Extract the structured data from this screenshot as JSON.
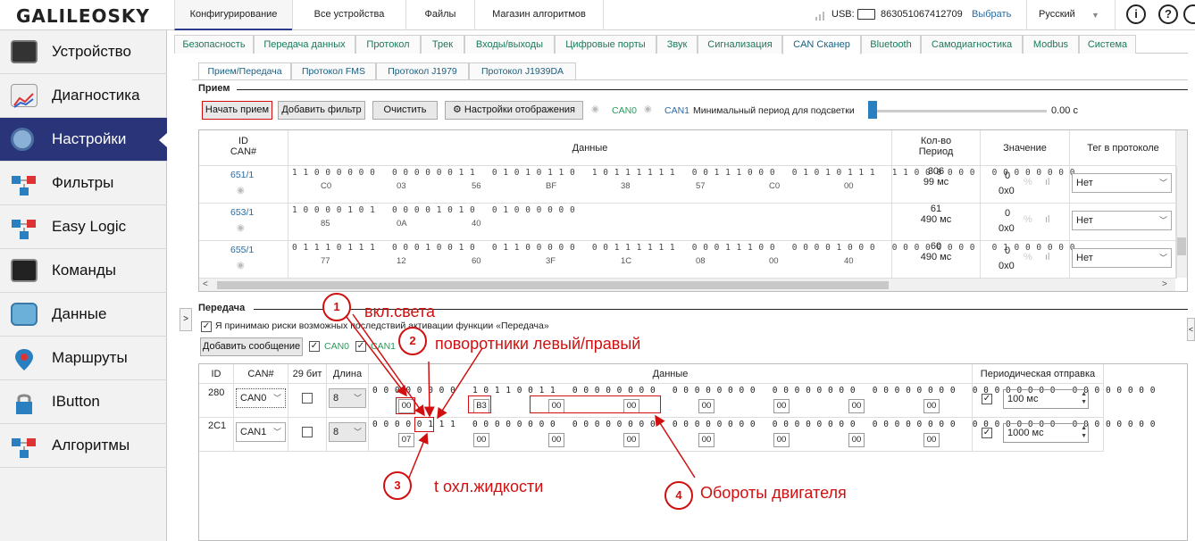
{
  "app": {
    "logo": "GALILEOSKY"
  },
  "top_tabs": [
    "Конфигурирование",
    "Все устройства",
    "Файлы",
    "Магазин алгоритмов"
  ],
  "usb": {
    "label": "USB:",
    "imei": "863051067412709",
    "choose": "Выбрать",
    "language": "Русский"
  },
  "sidebar": {
    "items": [
      {
        "label": "Устройство",
        "icon": "device-icon"
      },
      {
        "label": "Диагностика",
        "icon": "diagnostics-chart-icon"
      },
      {
        "label": "Настройки",
        "icon": "gear-icon"
      },
      {
        "label": "Фильтры",
        "icon": "filter-nodes-icon"
      },
      {
        "label": "Easy Logic",
        "icon": "logic-nodes-icon"
      },
      {
        "label": "Команды",
        "icon": "terminal-icon"
      },
      {
        "label": "Данные",
        "icon": "data-icon"
      },
      {
        "label": "Маршруты",
        "icon": "map-pin-icon"
      },
      {
        "label": "IButton",
        "icon": "lock-icon"
      },
      {
        "label": "Алгоритмы",
        "icon": "algorithm-nodes-icon"
      }
    ]
  },
  "settings_tabs": [
    "Безопасность",
    "Передача данных",
    "Протокол",
    "Трек",
    "Входы/выходы",
    "Цифровые порты",
    "Звук",
    "Сигнализация",
    "CAN Сканер",
    "Bluetooth",
    "Самодиагностика",
    "Modbus",
    "Система"
  ],
  "sub_tabs": [
    "Прием/Передача",
    "Протокол FMS",
    "Протокол J1979",
    "Протокол J1939DA"
  ],
  "receive": {
    "title": "Прием",
    "start_btn": "Начать прием",
    "add_filter_btn": "Добавить фильтр",
    "clear_btn": "Очистить",
    "display_settings_btn": "Настройки отображения",
    "can0": "CAN0",
    "can1": "CAN1",
    "min_period_label": "Минимальный период для подсветки",
    "slider_value": "0.00 с",
    "headers": {
      "id1": "ID",
      "id2": "CAN#",
      "data": "Данные",
      "count1": "Кол-во",
      "count2": "Период",
      "value": "Значение",
      "tag": "Тег в протоколе"
    },
    "rows": [
      {
        "id": "651/1",
        "bits": "1 1 0 0 0 0 0 0   0 0 0 0 0 0 1 1   0 1 0 1 0 1 1 0   1 0 1 1 1 1 1 1   0 0 1 1 1 0 0 0   0 1 0 1 0 1 1 1   1 1 0 0 0 0 0 0   0 0 0 0 0 0 0 0",
        "hex": [
          "C0",
          "03",
          "56",
          "BF",
          "38",
          "57",
          "C0",
          "00"
        ],
        "count": "306",
        "period": "99 мс",
        "val1": "0",
        "val2": "0x0",
        "tag": "Нет"
      },
      {
        "id": "653/1",
        "bits": "1 0 0 0 0 1 0 1   0 0 0 0 1 0 1 0   0 1 0 0 0 0 0 0",
        "hex": [
          "85",
          "0A",
          "40"
        ],
        "count": "61",
        "period": "490 мс",
        "val1": "0",
        "val2": "0x0",
        "tag": "Нет"
      },
      {
        "id": "655/1",
        "bits": "0 1 1 1 0 1 1 1   0 0 0 1 0 0 1 0   0 1 1 0 0 0 0 0   0 0 1 1 1 1 1 1   0 0 0 1 1 1 0 0   0 0 0 0 1 0 0 0   0 0 0 0 0 0 0 0   0 1 0 0 0 0 0 0",
        "hex": [
          "77",
          "12",
          "60",
          "3F",
          "1C",
          "08",
          "00",
          "40"
        ],
        "count": "60",
        "period": "490 мс",
        "val1": "0",
        "val2": "0x0",
        "tag": "Нет"
      }
    ]
  },
  "transmit": {
    "title": "Передача",
    "accept_text": "Я принимаю риски возможных последствий активации функции «Передача»",
    "add_msg_btn": "Добавить сообщение",
    "can0": "CAN0",
    "can1": "CAN1",
    "headers": {
      "id": "ID",
      "can": "CAN#",
      "bit29": "29 бит",
      "len": "Длина",
      "data": "Данные",
      "periodic": "Периодическая отправка"
    },
    "rows": [
      {
        "id": "280",
        "can": "CAN0",
        "len": "8",
        "bits": "0 0 0 0 0 0 0 0   1 0 1 1 0 0 1 1   0 0 0 0 0 0 0 0   0 0 0 0 0 0 0 0   0 0 0 0 0 0 0 0   0 0 0 0 0 0 0 0   0 0 0 0 0 0 0 0   0 0 0 0 0 0 0 0",
        "hex": [
          "00",
          "B3",
          "00",
          "00",
          "00",
          "00",
          "00",
          "00"
        ],
        "period": "100 мс"
      },
      {
        "id": "2C1",
        "can": "CAN1",
        "len": "8",
        "bits": "0 0 0 0 0 1 1 1   0 0 0 0 0 0 0 0   0 0 0 0 0 0 0 0   0 0 0 0 0 0 0 0   0 0 0 0 0 0 0 0   0 0 0 0 0 0 0 0   0 0 0 0 0 0 0 0   0 0 0 0 0 0 0 0",
        "hex": [
          "07",
          "00",
          "00",
          "00",
          "00",
          "00",
          "00",
          "00"
        ],
        "period": "1000 мс"
      }
    ]
  },
  "annotations": [
    {
      "num": "1",
      "text": "вкл.света"
    },
    {
      "num": "2",
      "text": "поворотники левый/правый"
    },
    {
      "num": "3",
      "text": "t охл.жидкости"
    },
    {
      "num": "4",
      "text": "Обороты двигателя"
    }
  ],
  "colors": {
    "sidebar_active": "#2a3478",
    "link": "#2a6aa0",
    "green": "#2a9a5a",
    "annotation_red": "#d01010"
  }
}
